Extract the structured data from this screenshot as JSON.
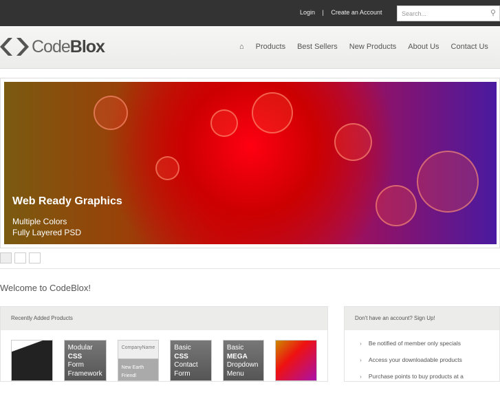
{
  "top": {
    "login": "Login",
    "divider": "|",
    "create": "Create an Account",
    "search_placeholder": "Search..."
  },
  "logo": {
    "light": "Code",
    "bold": "Blox"
  },
  "nav": [
    "Products",
    "Best Sellers",
    "New Products",
    "About Us",
    "Contact Us"
  ],
  "slide": {
    "title": "Web Ready Graphics",
    "line1": "Multiple Colors",
    "line2": "Fully Layered PSD"
  },
  "welcome": "Welcome to CodeBlox!",
  "recent": {
    "title": "Recently Added Products",
    "items": [
      {
        "l1": "",
        "l2": "",
        "l3": ""
      },
      {
        "l1": "Modular",
        "l2": "CSS",
        "l3": "Form Framework"
      },
      {
        "l1": "CompanyName",
        "l2": "",
        "l3": "New Earth Friendl"
      },
      {
        "l1": "Basic",
        "l2": "CSS",
        "l3": "Contact Form"
      },
      {
        "l1": "Basic",
        "l2": "MEGA",
        "l3": "Dropdown Menu"
      },
      {
        "l1": "",
        "l2": "",
        "l3": ""
      }
    ]
  },
  "signup": {
    "title": "Don't have an account? Sign Up!",
    "items": [
      "Be notified of member only specials",
      "Access your downloadable products",
      "Purchase points to buy products at a"
    ]
  }
}
